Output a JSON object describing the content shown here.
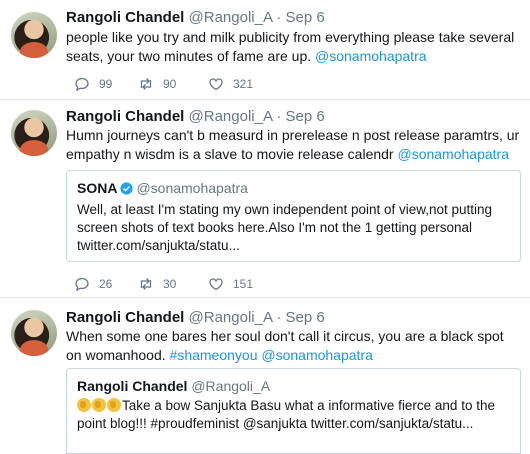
{
  "tweets": [
    {
      "name": "Rangoli Chandel",
      "handle": "@Rangoli_A",
      "sep": "·",
      "date": "Sep 6",
      "text": "people like you try and milk publicity from everything please take several seats, your two minutes of fame are up.",
      "mention": "@sonamohapatra",
      "replies": "99",
      "retweets": "90",
      "likes": "321"
    },
    {
      "name": "Rangoli Chandel",
      "handle": "@Rangoli_A",
      "sep": "·",
      "date": "Sep 6",
      "text": "Humn journeys can't b measurd in prerelease n post release paramtrs, ur empathy n wisdm is a slave to movie release calendr",
      "mention": "@sonamohapatra",
      "quote": {
        "name": "SONA",
        "handle": "@sonamohapatra",
        "text": "Well, at least I'm stating my own independent point of view,not putting screen shots of text books here.Also I'm not the 1 getting personal twitter.com/sanjukta/statu..."
      },
      "replies": "26",
      "retweets": "30",
      "likes": "151"
    },
    {
      "name": "Rangoli Chandel",
      "handle": "@Rangoli_A",
      "sep": "·",
      "date": "Sep 6",
      "text": "When some one bares her soul don't call it circus, you are a black spot on womanhood.",
      "hashtag": "#shameonyou",
      "mention": "@sonamohapatra",
      "quote": {
        "name": "Rangoli Chandel",
        "handle": "@Rangoli_A",
        "text": "Take a bow Sanjukta Basu what a informative fierce and to the point blog!!! #proudfeminist @sanjukta twitter.com/sanjukta/statu..."
      }
    }
  ],
  "icons": {
    "reply": "reply-icon",
    "retweet": "retweet-icon",
    "like": "heart-icon",
    "verified": "verified-badge-icon",
    "clap": "clapping-hands-emoji"
  },
  "colors": {
    "link": "#1b95e0",
    "muted": "#657786",
    "border": "#e1e8ed",
    "verified": "#1da1f2"
  }
}
